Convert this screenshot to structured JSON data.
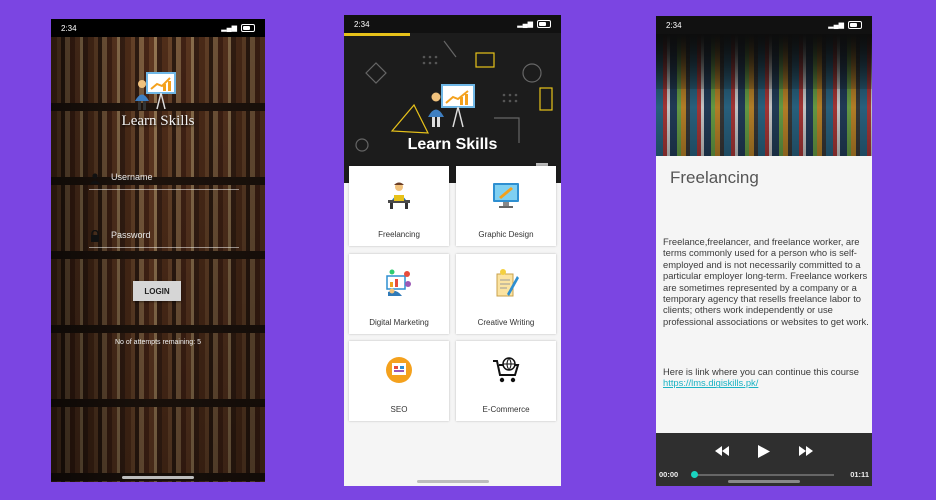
{
  "login_screen": {
    "status": {
      "time": "2:34"
    },
    "app_title": "Learn Skills",
    "username_placeholder": "Username",
    "password_placeholder": "Password",
    "login_button": "LOGIN",
    "attempts_text": "No of attempts remaining: 5"
  },
  "grid_screen": {
    "status": {
      "time": "2:34"
    },
    "app_title": "Learn Skills",
    "tiles": [
      {
        "label": "Freelancing",
        "icon": "freelancer-icon"
      },
      {
        "label": "Graphic Design",
        "icon": "graphic-design-icon"
      },
      {
        "label": "Digital Marketing",
        "icon": "digital-marketing-icon"
      },
      {
        "label": "Creative Writing",
        "icon": "creative-writing-icon"
      },
      {
        "label": "SEO",
        "icon": "seo-icon"
      },
      {
        "label": "E-Commerce",
        "icon": "shopping-cart-icon"
      }
    ],
    "accent_color": "#e7c21a"
  },
  "detail_screen": {
    "status": {
      "time": "2:34"
    },
    "title": "Freelancing",
    "description": "Freelance,freelancer, and freelance worker, are terms commonly used for a person who is self-employed and is not necessarily committed to a particular employer long-term. Freelance workers are sometimes represented by a company or a temporary agency that resells freelance labor to clients; others work independently or use professional associations or websites to get work.",
    "continue_text": "Here is link where you can continue this course",
    "link": "https://lms.digiskills.pk/",
    "player": {
      "current_time": "00:00",
      "total_time": "01:11",
      "progress": 0.0,
      "accent_color": "#1ad3c0"
    }
  },
  "background_color": "#7b45e2"
}
